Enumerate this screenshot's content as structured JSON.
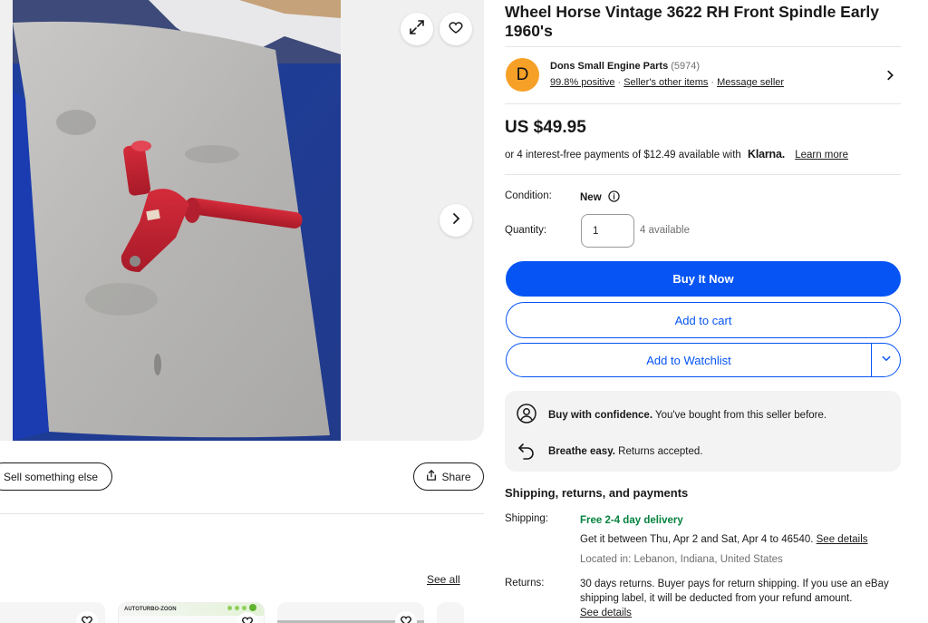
{
  "gallery": {
    "expand_icon": "expand-icon",
    "watch_icon": "heart-icon",
    "next_icon": "chevron-right-icon"
  },
  "left_actions": {
    "sell_label": "Sell something else",
    "share_label": "Share",
    "see_all_label": "See all",
    "thumb_brand": "AUTOTURBO-ZOON"
  },
  "item": {
    "title": "Wheel Horse Vintage 3622 RH Front Spindle Early 1960's"
  },
  "seller": {
    "initial": "D",
    "name": "Dons Small Engine Parts",
    "feedback_count": "(5974)",
    "positive": "99.8% positive",
    "other_items": "Seller's other items",
    "message": "Message seller"
  },
  "pricing": {
    "price": "US $49.95",
    "installments": "or 4 interest-free payments of $12.49 available with",
    "klarna": "Klarna.",
    "learn_more": "Learn more"
  },
  "condition": {
    "label": "Condition:",
    "value": "New"
  },
  "quantity": {
    "label": "Quantity:",
    "value": "1",
    "available": "4 available"
  },
  "buttons": {
    "buy_now": "Buy It Now",
    "add_to_cart": "Add to cart",
    "add_to_watchlist": "Add to Watchlist"
  },
  "confidence": {
    "row1_bold": "Buy with confidence.",
    "row1_text": "You've bought from this seller before.",
    "row2_bold": "Breathe easy.",
    "row2_text": "Returns accepted."
  },
  "shipping": {
    "heading": "Shipping, returns, and payments",
    "shipping_label": "Shipping:",
    "delivery": "Free 2-4 day delivery",
    "estimate": "Get it between Thu, Apr 2 and Sat, Apr 4 to 46540.",
    "see_details": "See details",
    "location": "Located in: Lebanon, Indiana, United States",
    "returns_label": "Returns:",
    "returns_text": "30 days returns. Buyer pays for return shipping. If you use an eBay shipping label, it will be deducted from your refund amount.",
    "returns_details": "See details"
  },
  "colors": {
    "primary_blue": "#0654f4",
    "avatar_orange": "#f7a027",
    "delivery_green": "#05823f"
  }
}
